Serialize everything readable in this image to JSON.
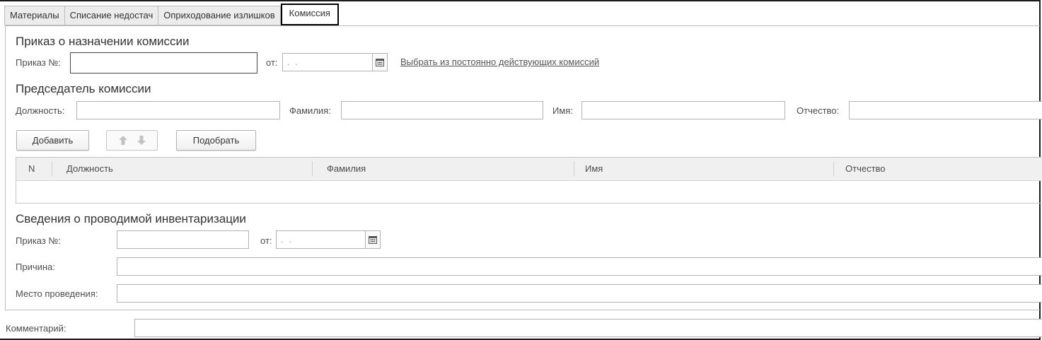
{
  "tabs": [
    {
      "label": "Материалы",
      "active": false
    },
    {
      "label": "Списание недостач",
      "active": false
    },
    {
      "label": "Оприходование излишков",
      "active": false
    },
    {
      "label": "Комиссия",
      "active": true
    }
  ],
  "order_section": {
    "title": "Приказ о назначении комиссии",
    "order_no_label": "Приказ №:",
    "order_no_value": "",
    "from_label": "от:",
    "date_value": " .  . ",
    "select_link": "Выбрать из постоянно действующих комиссий"
  },
  "chairman_section": {
    "title": "Председатель комиссии",
    "position_label": "Должность:",
    "surname_label": "Фамилия:",
    "name_label": "Имя:",
    "patronymic_label": "Отчество:"
  },
  "toolbar": {
    "add_label": "Добавить",
    "pick_label": "Подобрать"
  },
  "members_table": {
    "columns": [
      "N",
      "Должность",
      "Фамилия",
      "Имя",
      "Отчество"
    ],
    "rows": []
  },
  "inventory_section": {
    "title": "Сведения о проводимой инвентаризации",
    "order_no_label": "Приказ №:",
    "from_label": "от:",
    "date_value": " .  . ",
    "reason_label": "Причина:",
    "place_label": "Место проведения:"
  },
  "comment_label": "Комментарий:",
  "icons": {
    "calendar": "calendar-icon",
    "up": "arrow-up-icon",
    "down": "arrow-down-icon"
  }
}
